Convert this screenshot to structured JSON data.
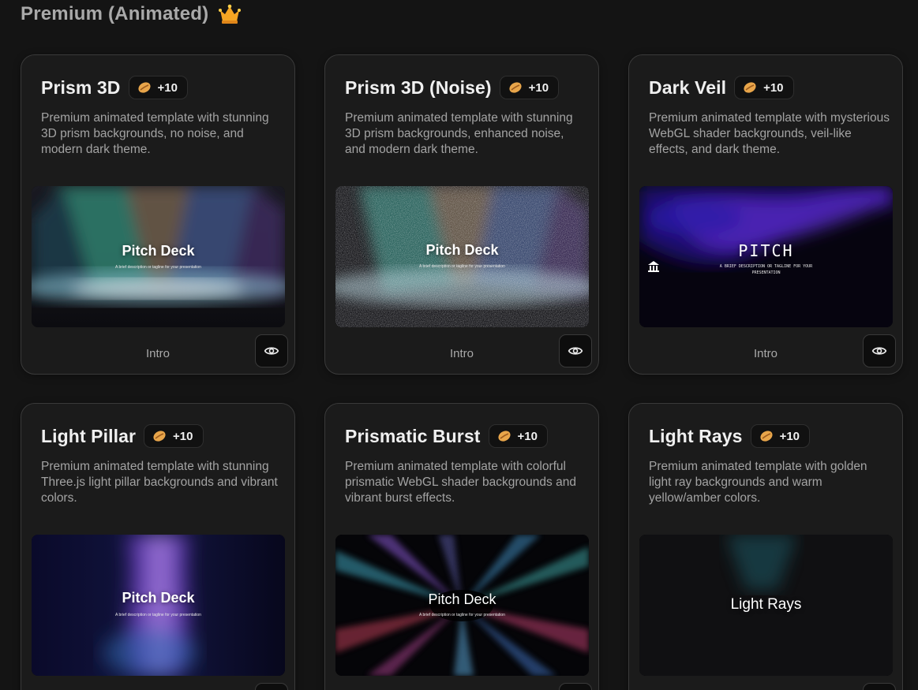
{
  "section": {
    "title": "Premium (Animated)",
    "icon": "crown-icon"
  },
  "cards": [
    {
      "title": "Prism 3D",
      "credits": "+10",
      "description": "Premium animated template with stunning 3D prism backgrounds, no noise, and modern dark theme.",
      "preview_title": "Pitch Deck",
      "preview_subtitle": "A brief description or tagline for your presentation",
      "footer_label": "Intro"
    },
    {
      "title": "Prism 3D (Noise)",
      "credits": "+10",
      "description": "Premium animated template with stunning 3D prism backgrounds, enhanced noise, and modern dark theme.",
      "preview_title": "Pitch Deck",
      "preview_subtitle": "A brief description or tagline for your presentation",
      "footer_label": "Intro"
    },
    {
      "title": "Dark Veil",
      "credits": "+10",
      "description": "Premium animated template with mysterious WebGL shader backgrounds, veil-like effects, and dark theme.",
      "preview_title": "PITCH",
      "preview_subtitle": "A BRIEF DESCRIPTION OR TAGLINE FOR YOUR PRESENTATION",
      "footer_label": "Intro"
    },
    {
      "title": "Light Pillar",
      "credits": "+10",
      "description": "Premium animated template with stunning Three.js light pillar backgrounds and vibrant colors.",
      "preview_title": "Pitch Deck",
      "preview_subtitle": "A brief description or tagline for your presentation",
      "footer_label": ""
    },
    {
      "title": "Prismatic Burst",
      "credits": "+10",
      "description": "Premium animated template with colorful prismatic WebGL shader backgrounds and vibrant burst effects.",
      "preview_title": "Pitch Deck",
      "preview_subtitle": "A brief description or tagline for your presentation",
      "footer_label": ""
    },
    {
      "title": "Light Rays",
      "credits": "+10",
      "description": "Premium animated template with golden light ray backgrounds and warm yellow/amber colors.",
      "preview_title": "Light Rays",
      "preview_subtitle": "",
      "footer_label": ""
    }
  ],
  "colors": {
    "background": "#141414",
    "card": "#1b1b1b",
    "border": "#3a3a3a",
    "crown": "#f5a623",
    "bean": "#e8a54a"
  }
}
